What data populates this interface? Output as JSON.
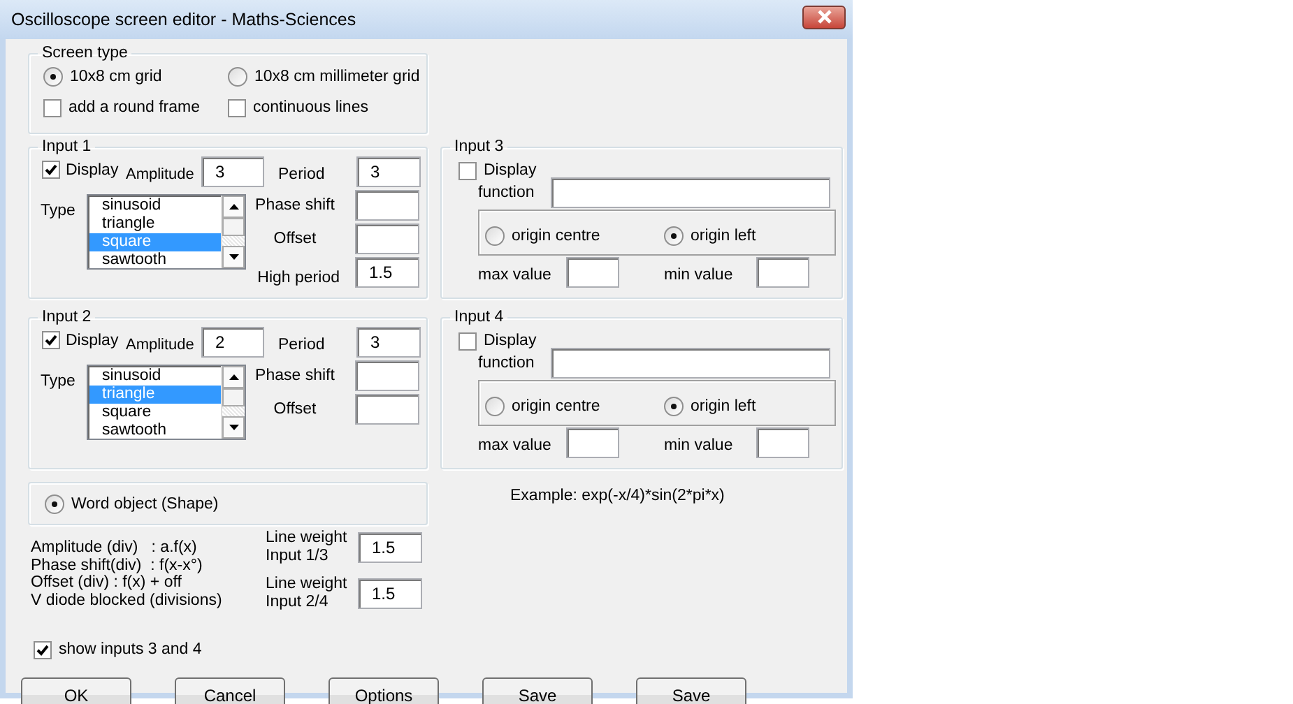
{
  "window": {
    "title": "Oscilloscope screen editor - Maths-Sciences"
  },
  "screen_type": {
    "title": "Screen type",
    "options": [
      {
        "label": "10x8 cm grid",
        "selected": true
      },
      {
        "label": "10x8 cm millimeter grid",
        "selected": false
      }
    ],
    "checkboxes": [
      {
        "label": "add a round frame",
        "checked": false
      },
      {
        "label": "continuous lines",
        "checked": false
      }
    ]
  },
  "wave_inputs": [
    {
      "title": "Input 1",
      "display": {
        "label": "Display",
        "checked": true
      },
      "amplitude_label": "Amplitude",
      "amplitude": "3",
      "period_label": "Period",
      "period": "3",
      "type_label": "Type",
      "types": [
        {
          "label": "sinusoid",
          "selected": false
        },
        {
          "label": "triangle",
          "selected": false
        },
        {
          "label": "square",
          "selected": true
        },
        {
          "label": "sawtooth",
          "selected": false
        }
      ],
      "phase_shift_label": "Phase shift",
      "offset_label": "Offset",
      "high_period_label": "High period",
      "high_period": "1.5"
    },
    {
      "title": "Input 2",
      "display": {
        "label": "Display",
        "checked": true
      },
      "amplitude_label": "Amplitude",
      "amplitude": "2",
      "period_label": "Period",
      "period": "3",
      "type_label": "Type",
      "types": [
        {
          "label": "sinusoid",
          "selected": false
        },
        {
          "label": "triangle",
          "selected": true
        },
        {
          "label": "square",
          "selected": false
        },
        {
          "label": "sawtooth",
          "selected": false
        }
      ],
      "phase_shift_label": "Phase shift",
      "offset_label": "Offset"
    }
  ],
  "function_inputs": [
    {
      "title": "Input 3",
      "display": {
        "label": "Display",
        "checked": false
      },
      "function_label": "function",
      "origins": [
        {
          "label": "origin centre",
          "selected": false
        },
        {
          "label": "origin left",
          "selected": true
        }
      ],
      "max_label": "max value",
      "min_label": "min value"
    },
    {
      "title": "Input 4",
      "display": {
        "label": "Display",
        "checked": false
      },
      "function_label": "function",
      "origins": [
        {
          "label": "origin centre",
          "selected": false
        },
        {
          "label": "origin left",
          "selected": true
        }
      ],
      "max_label": "max value",
      "min_label": "min value"
    }
  ],
  "output": {
    "label": "Word object (Shape)",
    "selected": true
  },
  "example": "Example: exp(-x/4)*sin(2*pi*x)",
  "notes": [
    "Amplitude (div)   : a.f(x)",
    "Phase shift(div)  : f(x-x°)",
    "Offset (div) : f(x) + off",
    "V diode blocked (divisions)"
  ],
  "line_weights": [
    {
      "label": "Line weight\nInput 1/3",
      "value": "1.5"
    },
    {
      "label": "Line weight\nInput 2/4",
      "value": "1.5"
    }
  ],
  "show_inputs": {
    "label": "show inputs 3 and 4",
    "checked": true
  },
  "buttons": [
    "OK",
    "Cancel",
    "Options",
    "Save",
    "Save"
  ]
}
